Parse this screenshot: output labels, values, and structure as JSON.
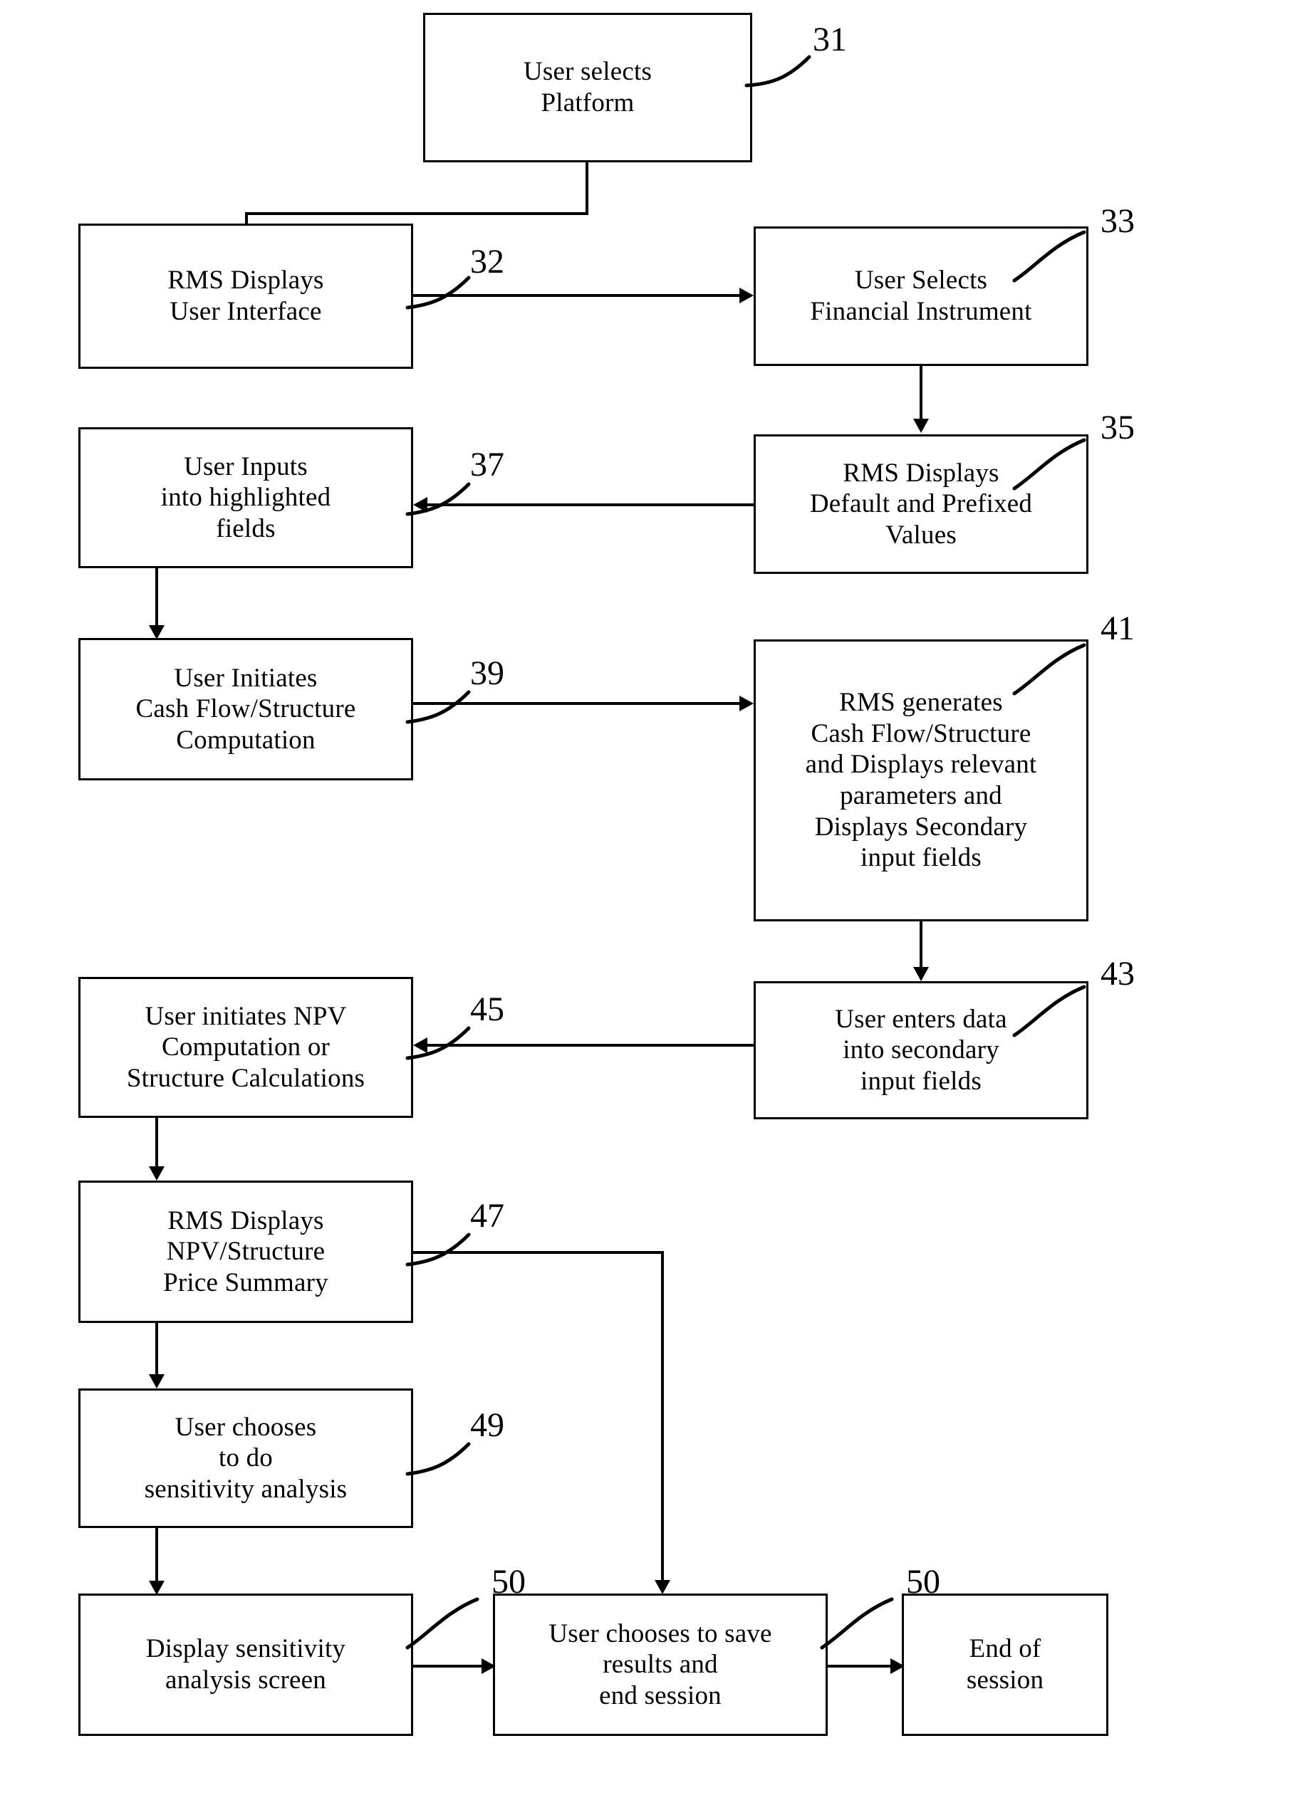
{
  "figure": {
    "type": "flowchart",
    "title": "",
    "nodes": [
      {
        "id": "31",
        "ref": "31",
        "text": "User selects\nPlatform"
      },
      {
        "id": "32",
        "ref": "32",
        "text": "RMS Displays\nUser Interface"
      },
      {
        "id": "33",
        "ref": "33",
        "text": "User Selects\nFinancial Instrument"
      },
      {
        "id": "35",
        "ref": "35",
        "text": "RMS Displays\nDefault and Prefixed\nValues"
      },
      {
        "id": "37",
        "ref": "37",
        "text": "User Inputs\ninto highlighted\nfields"
      },
      {
        "id": "39",
        "ref": "39",
        "text": "User Initiates\nCash Flow/Structure\nComputation"
      },
      {
        "id": "41",
        "ref": "41",
        "text": "RMS generates\nCash Flow/Structure\nand Displays relevant\nparameters and\nDisplays Secondary\ninput fields"
      },
      {
        "id": "43",
        "ref": "43",
        "text": "User enters data\ninto secondary\ninput fields"
      },
      {
        "id": "45",
        "ref": "45",
        "text": "User initiates NPV\nComputation or\nStructure Calculations"
      },
      {
        "id": "47",
        "ref": "47",
        "text": "RMS Displays\nNPV/Structure\nPrice Summary"
      },
      {
        "id": "49",
        "ref": "49",
        "text": "User chooses\nto do\nsensitivity analysis"
      },
      {
        "id": "50a",
        "ref": "50",
        "text": "Display sensitivity\nanalysis screen"
      },
      {
        "id": "50b",
        "ref": "50",
        "text": "User chooses to save\nresults and\nend session"
      },
      {
        "id": "end",
        "ref": "",
        "text": "End of\nsession"
      }
    ],
    "edges": [
      {
        "from": "31",
        "to": "32"
      },
      {
        "from": "32",
        "to": "33"
      },
      {
        "from": "33",
        "to": "35"
      },
      {
        "from": "35",
        "to": "37"
      },
      {
        "from": "37",
        "to": "39"
      },
      {
        "from": "39",
        "to": "41"
      },
      {
        "from": "41",
        "to": "43"
      },
      {
        "from": "43",
        "to": "45"
      },
      {
        "from": "45",
        "to": "47"
      },
      {
        "from": "47",
        "to": "49"
      },
      {
        "from": "47",
        "to": "50b"
      },
      {
        "from": "49",
        "to": "50a"
      },
      {
        "from": "50a",
        "to": "50b"
      },
      {
        "from": "50b",
        "to": "end"
      }
    ]
  },
  "labels": {
    "n31": "User selects\nPlatform",
    "n32": "RMS Displays\nUser Interface",
    "n33": "User Selects\nFinancial Instrument",
    "n35": "RMS Displays\nDefault and Prefixed\nValues",
    "n37": "User Inputs\ninto highlighted\nfields",
    "n39": "User Initiates\nCash Flow/Structure\nComputation",
    "n41": "RMS generates\nCash Flow/Structure\nand Displays relevant\nparameters and\nDisplays Secondary\ninput fields",
    "n43": "User enters data\ninto secondary\ninput fields",
    "n45": "User initiates NPV\nComputation or\nStructure Calculations",
    "n47": "RMS Displays\nNPV/Structure\nPrice Summary",
    "n49": "User chooses\nto do\nsensitivity analysis",
    "n50a": "Display sensitivity\nanalysis screen",
    "n50b": "User chooses to save\nresults and\nend session",
    "nEnd": "End of\nsession"
  },
  "refs": {
    "r31": "31",
    "r32": "32",
    "r33": "33",
    "r35": "35",
    "r37": "37",
    "r39": "39",
    "r41": "41",
    "r43": "43",
    "r45": "45",
    "r47": "47",
    "r49": "49",
    "r50a": "50",
    "r50b": "50"
  },
  "colors": {
    "ink": "#000000",
    "paper": "#ffffff"
  }
}
